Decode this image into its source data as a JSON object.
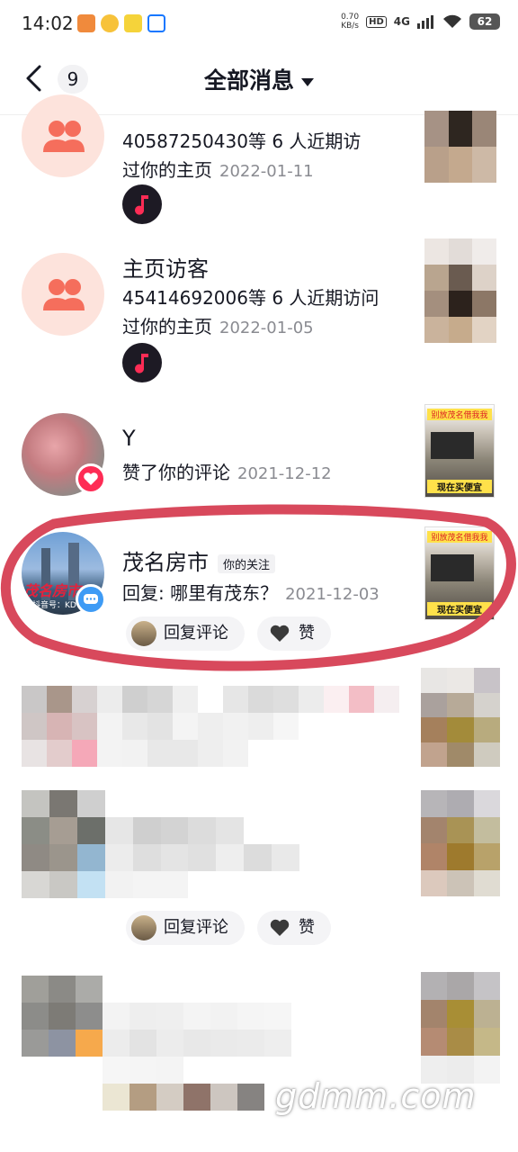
{
  "status_bar": {
    "time": "14:02",
    "net_speed": "0.70",
    "net_speed_unit": "KB/s",
    "hd": "HD",
    "network": "4G",
    "battery": "62"
  },
  "nav": {
    "unread_count": "9",
    "title": "全部消息"
  },
  "messages": [
    {
      "desc_line1": "40587250430等 6 人近期访",
      "desc_line2": "过你的主页",
      "date": "2022-01-11"
    },
    {
      "name": "主页访客",
      "desc_line1": "45414692006等 6 人近期访问",
      "desc_line2": "过你的主页",
      "date": "2022-01-05"
    },
    {
      "name": "Y",
      "desc": "赞了你的评论",
      "date": "2021-12-12"
    },
    {
      "name": "茂名房市",
      "tag": "你的关注",
      "desc": "回复: 哪里有茂东？",
      "date": "2021-12-03",
      "reply_label": "回复评论",
      "like_label": "赞",
      "avatar_text": "茂名房市",
      "avatar_subtext": "抖音号：KD"
    },
    {
      "reply_label": "回复评论",
      "like_label": "赞"
    }
  ],
  "thumb_text": {
    "top": "别放茂名借我我",
    "bottom": "现在买便宜"
  },
  "watermark": "gdmm.com",
  "colors": {
    "accent_red": "#fe2c55",
    "visitor_bg": "#fde3dc",
    "visitor_icon": "#f56e5c",
    "annotation_red": "#d8495c",
    "comment_blue": "#3e9bf5"
  }
}
